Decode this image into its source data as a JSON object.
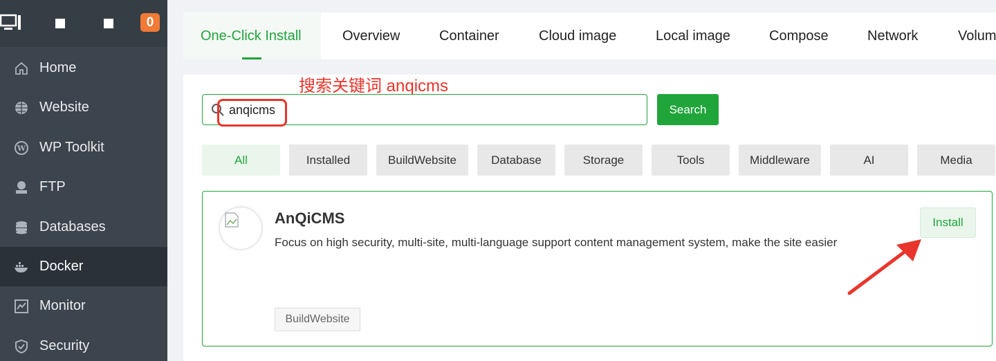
{
  "sidebar": {
    "badge": "0",
    "items": [
      {
        "label": "Home",
        "icon": "home-icon"
      },
      {
        "label": "Website",
        "icon": "globe-icon"
      },
      {
        "label": "WP Toolkit",
        "icon": "wordpress-icon"
      },
      {
        "label": "FTP",
        "icon": "ftp-icon"
      },
      {
        "label": "Databases",
        "icon": "database-icon"
      },
      {
        "label": "Docker",
        "icon": "docker-icon",
        "active": true
      },
      {
        "label": "Monitor",
        "icon": "monitor-icon"
      },
      {
        "label": "Security",
        "icon": "shield-icon"
      }
    ]
  },
  "tabs": [
    "One-Click Install",
    "Overview",
    "Container",
    "Cloud image",
    "Local image",
    "Compose",
    "Network",
    "Volum"
  ],
  "annotation": {
    "text": "搜索关键词 anqicms",
    "color": "#e8352b"
  },
  "search": {
    "value": "anqicms",
    "button": "Search"
  },
  "filters": [
    "All",
    "Installed",
    "BuildWebsite",
    "Database",
    "Storage",
    "Tools",
    "Middleware",
    "AI",
    "Media"
  ],
  "app": {
    "name": "AnQiCMS",
    "description": "Focus on high security, multi-site, multi-language support content management system, make the site easier",
    "install_label": "Install",
    "tag": "BuildWebsite"
  },
  "colors": {
    "accent": "#20a53a",
    "sidebar": "#3c444d",
    "badge": "#f07a36"
  }
}
